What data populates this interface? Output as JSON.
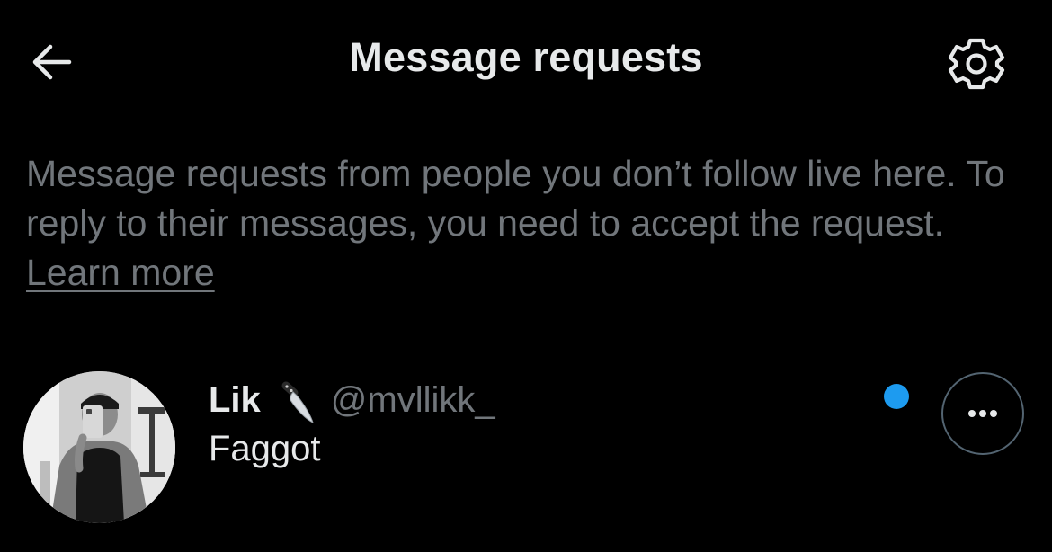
{
  "header": {
    "title": "Message requests",
    "back_icon": "arrow-left-icon",
    "settings_icon": "gear-icon"
  },
  "info": {
    "text": "Message requests from people you don’t follow live here. To reply to their messages, you need to accept the request.",
    "learn_more": "Learn more"
  },
  "requests": [
    {
      "display_name": "Lik",
      "name_emoji": "kitchen-knife-icon",
      "handle": "@mvllikk_",
      "preview": "Faggot",
      "unread": true,
      "more_icon": "more-horizontal-icon"
    }
  ],
  "colors": {
    "background": "#000000",
    "primary_text": "#e7e9ea",
    "secondary_text": "#71767b",
    "accent": "#1d9bf0",
    "border": "#536471"
  }
}
